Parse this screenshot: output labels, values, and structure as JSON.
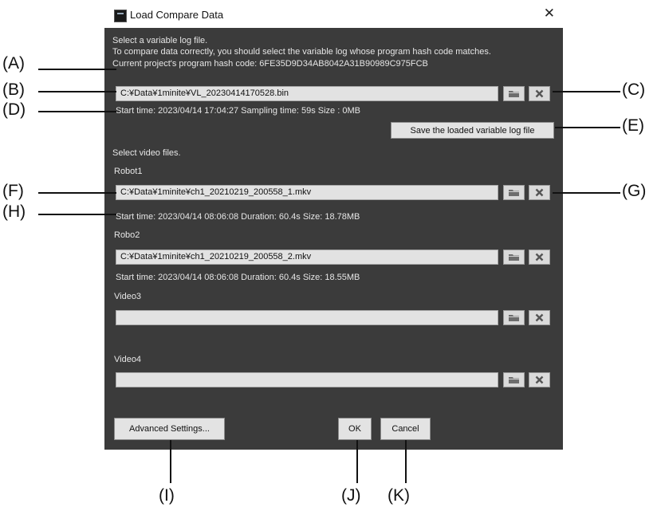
{
  "dialog": {
    "title": "Load Compare Data",
    "close_glyph": "✕",
    "intro_line1": "Select a variable log file.",
    "intro_line2": "To compare data correctly, you should select the variable log whose program hash code matches.",
    "hash_line": "Current project's program hash code:  6FE35D9D34AB8042A31B90989C975FCB",
    "log_file": {
      "path": "C:¥Data¥1minite¥VL_20230414170528.bin",
      "info": "Start time: 2023/04/14 17:04:27    Sampling time: 59s    Size : 0MB"
    },
    "save_log_label": "Save the loaded variable log file",
    "select_video_label": "Select video files.",
    "videos": [
      {
        "label": "Robot1",
        "path": "C:¥Data¥1minite¥ch1_20210219_200558_1.mkv",
        "info": "Start time: 2023/04/14 08:06:08       Duration: 60.4s    Size: 18.78MB"
      },
      {
        "label": "Robo2",
        "path": "C:¥Data¥1minite¥ch1_20210219_200558_2.mkv",
        "info": "Start time: 2023/04/14 08:06:08       Duration: 60.4s    Size: 18.55MB"
      },
      {
        "label": "Video3",
        "path": "",
        "info": ""
      },
      {
        "label": "Video4",
        "path": "",
        "info": ""
      }
    ],
    "advanced_label": "Advanced Settings...",
    "ok_label": "OK",
    "cancel_label": "Cancel"
  },
  "callouts": {
    "A": "(A)",
    "B": "(B)",
    "C": "(C)",
    "D": "(D)",
    "E": "(E)",
    "F": "(F)",
    "G": "(G)",
    "H": "(H)",
    "I": "(I)",
    "J": "(J)",
    "K": "(K)"
  },
  "icons": {
    "browse": "folder-icon",
    "clear": "clear-x-icon",
    "app": "app-icon"
  },
  "colors": {
    "dialog_bg": "#3b3b3b",
    "field_bg": "#e2e2e2",
    "text": "#e6e6e6"
  }
}
